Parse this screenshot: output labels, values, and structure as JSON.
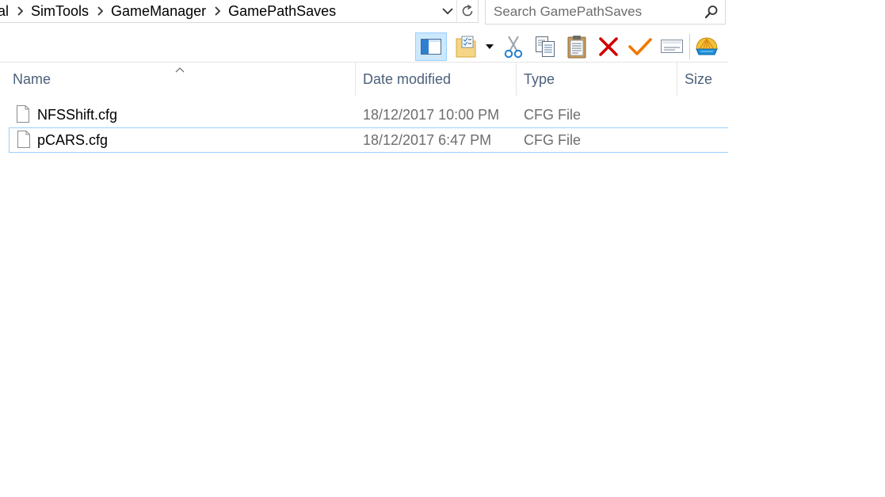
{
  "breadcrumb": {
    "items": [
      "al",
      "SimTools",
      "GameManager",
      "GamePathSaves"
    ]
  },
  "search": {
    "placeholder": "Search GamePathSaves"
  },
  "toolbar": {
    "buttons": [
      {
        "name": "preview-pane-button",
        "icon": "preview-pane-icon",
        "pressed": true
      },
      {
        "name": "properties-button",
        "icon": "properties-folder-icon",
        "pressed": false
      },
      {
        "name": "properties-dropdown-button",
        "icon": "dropdown-arrow-icon",
        "pressed": false
      },
      {
        "name": "cut-button",
        "icon": "scissors-icon",
        "pressed": false
      },
      {
        "name": "copy-button",
        "icon": "copy-icon",
        "pressed": false
      },
      {
        "name": "paste-button",
        "icon": "clipboard-icon",
        "pressed": false
      },
      {
        "name": "delete-button",
        "icon": "red-x-icon",
        "pressed": false
      },
      {
        "name": "select-button",
        "icon": "orange-checkmark-icon",
        "pressed": false
      },
      {
        "name": "rename-button",
        "icon": "rename-icon",
        "pressed": false
      },
      {
        "name": "shell-button",
        "icon": "shell-icon",
        "pressed": false
      }
    ]
  },
  "columns": {
    "name": "Name",
    "date_modified": "Date modified",
    "type": "Type",
    "size": "Size"
  },
  "files": [
    {
      "name": "NFSShift.cfg",
      "date": "18/12/2017 10:00 PM",
      "type": "CFG File",
      "size": "",
      "selected": false
    },
    {
      "name": "pCARS.cfg",
      "date": "18/12/2017 6:47 PM",
      "type": "CFG File",
      "size": "",
      "selected": true
    }
  ],
  "colors": {
    "selection_border": "#99d1ff",
    "pressed_bg": "#cce8ff",
    "header_text": "#4c607a",
    "detail_text": "#6d6d6d",
    "delete_red": "#d10000",
    "check_orange": "#f07800"
  }
}
